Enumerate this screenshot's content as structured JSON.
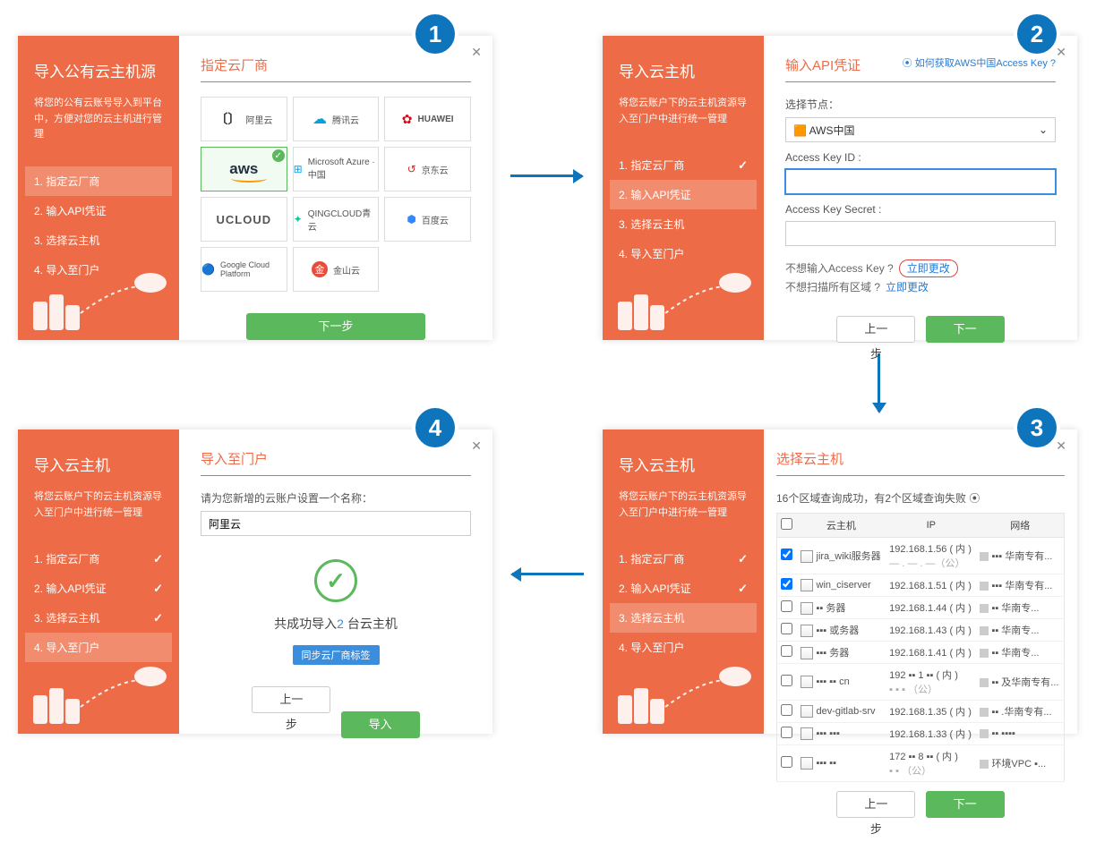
{
  "panels": {
    "p1": {
      "title": "导入公有云主机源",
      "desc": "将您的公有云账号导入到平台中，方便对您的云主机进行管理",
      "steps": [
        "1. 指定云厂商",
        "2. 输入API凭证",
        "3. 选择云主机",
        "4. 导入至门户"
      ],
      "heading": "指定云厂商",
      "vendors": [
        "阿里云",
        "腾讯云",
        "HUAWEI",
        "aws",
        "Microsoft Azure · 中国",
        "京东云",
        "UCLOUD",
        "QINGCLOUD青云",
        "百度云",
        "Google Cloud Platform",
        "金山云"
      ],
      "next": "下一步"
    },
    "p2": {
      "title": "导入云主机",
      "desc": "将您云账户下的云主机资源导入至门户中进行统一管理",
      "steps": [
        "1. 指定云厂商",
        "2. 输入API凭证",
        "3. 选择云主机",
        "4. 导入至门户"
      ],
      "heading": "输入API凭证",
      "toplink": "⦿ 如何获取AWS中国Access Key ?",
      "node_lbl": "选择节点：",
      "node_val": "🟧 AWS中国",
      "akid_lbl": "Access Key ID :",
      "aks_lbl": "Access Key Secret :",
      "q1": "不想输入Access Key ?",
      "q2": "不想扫描所有区域 ?",
      "change": "立即更改",
      "prev": "上一步",
      "next": "下一步"
    },
    "p3": {
      "title": "导入云主机",
      "desc": "将您云账户下的云主机资源导入至门户中进行统一管理",
      "steps": [
        "1. 指定云厂商",
        "2. 输入API凭证",
        "3. 选择云主机",
        "4. 导入至门户"
      ],
      "heading": "选择云主机",
      "status": "16个区域查询成功，有2个区域查询失败 ⦿",
      "cols": [
        "云主机",
        "IP",
        "网络"
      ],
      "rows": [
        {
          "c": true,
          "name": "jira_wiki服务器",
          "ip": "192.168.1.56 ( 内 )",
          "ip2": "— . — . —（公）",
          "net": "▪▪▪ 华南专有..."
        },
        {
          "c": true,
          "name": "win_ciserver",
          "ip": "192.168.1.51 ( 内 )",
          "ip2": "",
          "net": "▪▪▪ 华南专有..."
        },
        {
          "c": false,
          "name": "▪▪ 务器",
          "ip": "192.168.1.44 ( 内 )",
          "ip2": "",
          "net": "▪▪ 华南专..."
        },
        {
          "c": false,
          "name": "▪▪▪ 或务器",
          "ip": "192.168.1.43 ( 内 )",
          "ip2": "",
          "net": "▪▪ 华南专..."
        },
        {
          "c": false,
          "name": "▪▪▪ 务器",
          "ip": "192.168.1.41 ( 内 )",
          "ip2": "",
          "net": "▪▪ 华南专..."
        },
        {
          "c": false,
          "name": "▪▪▪  ▪▪  cn",
          "ip": "192 ▪▪ 1 ▪▪ ( 内 )",
          "ip2": "▪  ▪  ▪ （公）",
          "net": "▪▪ 及华南专有..."
        },
        {
          "c": false,
          "name": "dev-gitlab-srv",
          "ip": "192.168.1.35 ( 内 )",
          "ip2": "",
          "net": "▪▪ .华南专有..."
        },
        {
          "c": false,
          "name": "▪▪▪ ▪▪▪",
          "ip": "192.168.1.33 ( 内 )",
          "ip2": "",
          "net": "▪▪ ▪▪▪▪"
        },
        {
          "c": false,
          "name": "▪▪▪ ▪▪",
          "ip": "172 ▪▪ 8 ▪▪ ( 内 )",
          "ip2": "▪  ▪ （公）",
          "net": "环境VPC ▪..."
        }
      ],
      "prev": "上一步",
      "next": "下一步"
    },
    "p4": {
      "title": "导入云主机",
      "desc": "将您云账户下的云主机资源导入至门户中进行统一管理",
      "steps": [
        "1. 指定云厂商",
        "2. 输入API凭证",
        "3. 选择云主机",
        "4. 导入至门户"
      ],
      "heading": "导入至门户",
      "name_lbl": "请为您新增的云账户设置一个名称：",
      "name_val": "阿里云",
      "result_pre": "共成功导入",
      "result_n": "2",
      "result_suf": " 台云主机",
      "tag": "同步云厂商标签",
      "prev": "上一步",
      "import": "导入"
    }
  }
}
